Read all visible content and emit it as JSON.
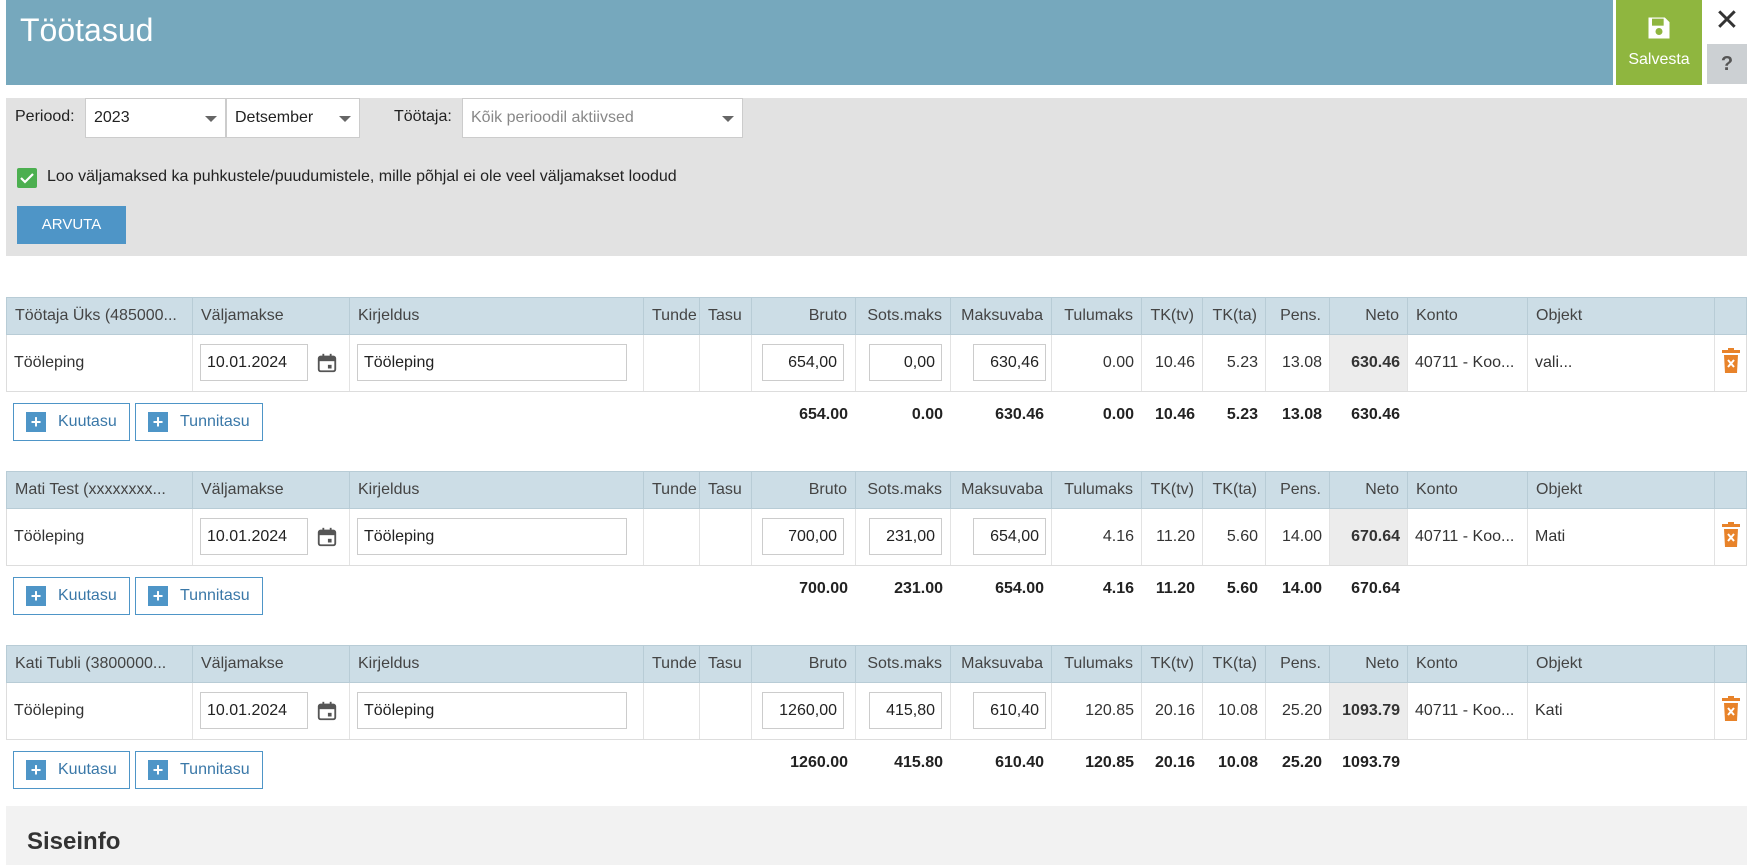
{
  "header": {
    "title": "Töötasud",
    "save_label": "Salvesta",
    "close_glyph": "✕",
    "help_glyph": "?"
  },
  "filters": {
    "period_label": "Periood:",
    "year_value": "2023",
    "month_value": "Detsember",
    "employee_label": "Töötaja:",
    "employee_placeholder": "Kõik perioodil aktiivsed",
    "checkbox_label": "Loo väljamaksed ka puhkustele/puudumistele, mille põhjal ei ole veel väljamakset loodud",
    "checkbox_checked": true,
    "calculate_label": "ARVUTA"
  },
  "columns": {
    "payout": "Väljamakse",
    "description": "Kirjeldus",
    "hours": "Tunde",
    "rate": "Tasu",
    "gross": "Bruto",
    "social_tax": "Sots.maks",
    "tax_free": "Maksuvaba",
    "income_tax": "Tulumaks",
    "tk_tv": "TK(tv)",
    "tk_ta": "TK(ta)",
    "pension": "Pens.",
    "net": "Neto",
    "account": "Konto",
    "object": "Objekt"
  },
  "buttons": {
    "monthly": "Kuutasu",
    "hourly": "Tunnitasu"
  },
  "employees": [
    {
      "name": "Töötaja Üks (485000...",
      "row": {
        "type": "Tööleping",
        "date": "10.01.2024",
        "description": "Tööleping",
        "gross": "654,00",
        "social_tax": "0,00",
        "tax_free": "630,46",
        "income_tax": "0.00",
        "tk_tv": "10.46",
        "tk_ta": "5.23",
        "pension": "13.08",
        "net": "630.46",
        "account": "40711 - Koo...",
        "object": "vali..."
      },
      "totals": {
        "gross": "654.00",
        "social_tax": "0.00",
        "tax_free": "630.46",
        "income_tax": "0.00",
        "tk_tv": "10.46",
        "tk_ta": "5.23",
        "pension": "13.08",
        "net": "630.46"
      }
    },
    {
      "name": "Mati Test (xxxxxxxx...",
      "row": {
        "type": "Tööleping",
        "date": "10.01.2024",
        "description": "Tööleping",
        "gross": "700,00",
        "social_tax": "231,00",
        "tax_free": "654,00",
        "income_tax": "4.16",
        "tk_tv": "11.20",
        "tk_ta": "5.60",
        "pension": "14.00",
        "net": "670.64",
        "account": "40711 - Koo...",
        "object": "Mati"
      },
      "totals": {
        "gross": "700.00",
        "social_tax": "231.00",
        "tax_free": "654.00",
        "income_tax": "4.16",
        "tk_tv": "11.20",
        "tk_ta": "5.60",
        "pension": "14.00",
        "net": "670.64"
      }
    },
    {
      "name": "Kati Tubli (3800000...",
      "row": {
        "type": "Tööleping",
        "date": "10.01.2024",
        "description": "Tööleping",
        "gross": "1260,00",
        "social_tax": "415,80",
        "tax_free": "610,40",
        "income_tax": "120.85",
        "tk_tv": "20.16",
        "tk_ta": "10.08",
        "pension": "25.20",
        "net": "1093.79",
        "account": "40711 - Koo...",
        "object": "Kati"
      },
      "totals": {
        "gross": "1260.00",
        "social_tax": "415.80",
        "tax_free": "610.40",
        "income_tax": "120.85",
        "tk_tv": "20.16",
        "tk_ta": "10.08",
        "pension": "25.20",
        "net": "1093.79"
      }
    }
  ],
  "siseinfo": {
    "title": "Siseinfo"
  },
  "colors": {
    "header_bg": "#76a8bd",
    "save_bg": "#8fb63f",
    "accent_blue": "#4e95c7",
    "link": "#3a78a8",
    "delete_orange": "#e8832a",
    "check_green": "#4caf50"
  }
}
